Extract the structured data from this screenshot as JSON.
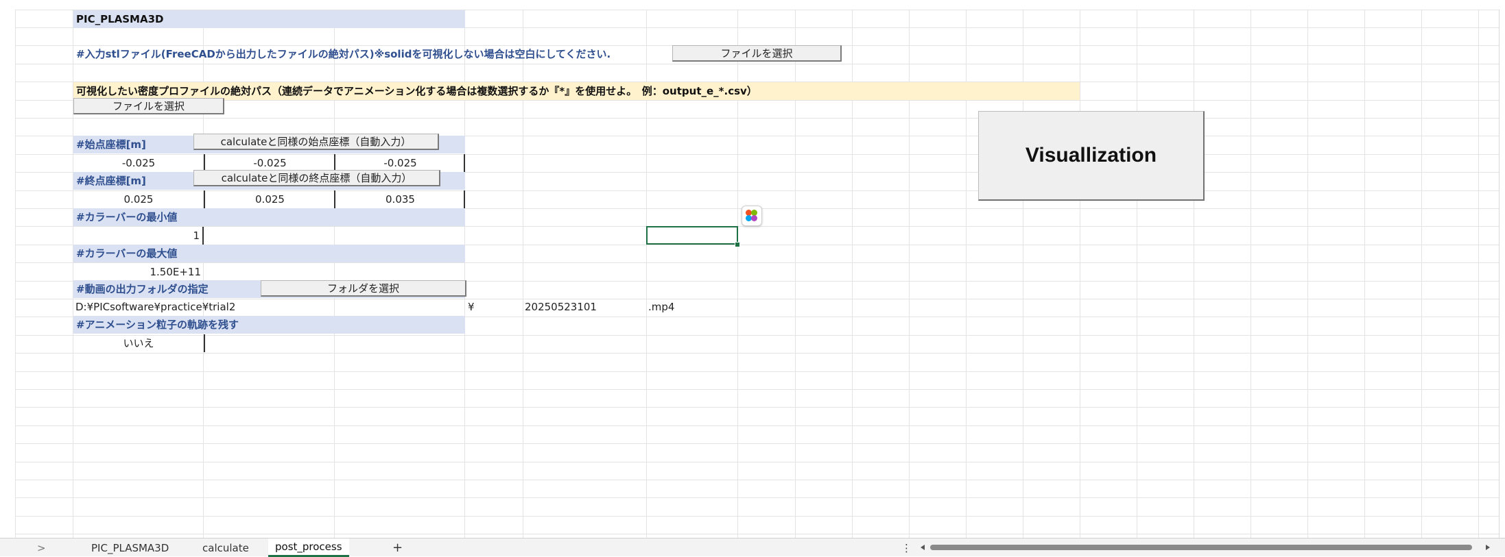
{
  "app": {
    "sheet_title": "PIC_PLASMA3D"
  },
  "stl": {
    "label": "#入力stlファイル(FreeCADから出力したファイルの絶対パス)※solidを可視化しない場合は空白にしてください.",
    "select_button": "ファイルを選択"
  },
  "density": {
    "label": "可視化したい密度プロファイルの絶対パス（連続データでアニメーション化する場合は複数選択するか『*』を使用せよ。　例：output_e_*.csv）",
    "select_button": "ファイルを選択"
  },
  "start": {
    "label": "#始点座標[m]",
    "button": "calculateと同様の始点座標（自動入力）",
    "values": [
      "-0.025",
      "-0.025",
      "-0.025"
    ]
  },
  "end": {
    "label": "#終点座標[m]",
    "button": "calculateと同様の終点座標（自動入力）",
    "values": [
      "0.025",
      "0.025",
      "0.035"
    ]
  },
  "colorbar_min": {
    "label": "#カラーバーの最小値",
    "value": "1"
  },
  "colorbar_max": {
    "label": "#カラーバーの最大値",
    "value": "1.50E+11"
  },
  "output": {
    "label": "#動画の出力フォルダの指定",
    "select_button": "フォルダを選択",
    "folder": "D:¥PICsoftware¥practice¥trial2",
    "sep": "¥",
    "name": "20250523101",
    "ext": ".mp4"
  },
  "trail": {
    "label": "#アニメーション粒子の軌跡を残す",
    "value": "いいえ"
  },
  "visualize_button": "Visuallization",
  "tabs": {
    "items": [
      "PIC_PLASMA3D",
      "calculate",
      "post_process"
    ],
    "add": "+",
    "prev": ">",
    "more": "⋮"
  },
  "colors": {
    "header_bg": "#d9e1f2",
    "note_bg": "#fff2cc",
    "selection": "#1e7145"
  }
}
